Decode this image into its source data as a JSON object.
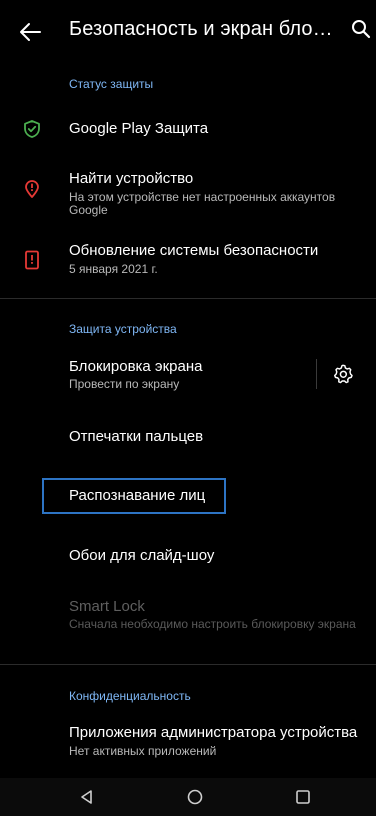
{
  "appbar": {
    "title": "Безопасность и экран блокировки",
    "back_icon": "arrow-back-icon",
    "search_icon": "search-icon"
  },
  "sections": {
    "protection_status": "Статус защиты",
    "device_protection": "Защита устройства",
    "privacy": "Конфиденциальность"
  },
  "items": {
    "google_play": {
      "title": "Google Play Защита",
      "icon": "shield-check-icon"
    },
    "find_device": {
      "title": "Найти устройство",
      "subtitle": "На этом устройстве нет настроенных аккаунтов Google",
      "icon": "location-alert-icon"
    },
    "security_update": {
      "title": "Обновление системы безопасности",
      "subtitle": "5 января 2021 г.",
      "icon": "phone-alert-icon"
    },
    "screen_lock": {
      "title": "Блокировка экрана",
      "subtitle": "Провести по экрану",
      "settings_icon": "gear-icon"
    },
    "fingerprints": {
      "title": "Отпечатки пальцев"
    },
    "face_recognition": {
      "title": "Распознавание лиц"
    },
    "slideshow_wallpaper": {
      "title": "Обои для слайд-шоу"
    },
    "smart_lock": {
      "title": "Smart Lock",
      "subtitle": "Сначала необходимо настроить блокировку экрана",
      "enabled": false
    },
    "device_admin": {
      "title": "Приложения администратора устройства",
      "subtitle": "Нет активных приложений"
    }
  },
  "navbar": {
    "back_icon": "nav-back-triangle-icon",
    "home_icon": "nav-home-circle-icon",
    "recents_icon": "nav-recents-square-icon"
  },
  "colors": {
    "background": "#000000",
    "accent": "#7fb7f5",
    "shield_green": "#4caf50",
    "alert_red": "#e53935",
    "focus_border": "#2d74c4"
  }
}
